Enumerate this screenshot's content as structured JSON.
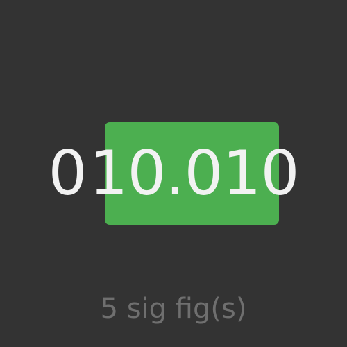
{
  "display": {
    "leading_digit": "0",
    "significant_part": "10.010"
  },
  "caption": {
    "text": "5 sig fig(s)"
  },
  "colors": {
    "background": "#333333",
    "highlight": "#4caf50",
    "digit": "#f2f2f2",
    "caption": "#6f6f6f"
  }
}
